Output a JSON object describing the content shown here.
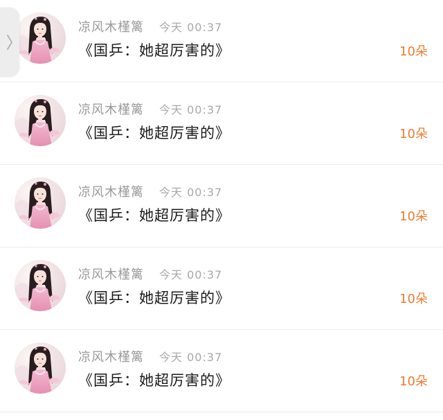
{
  "colors": {
    "name": "#9a9a9a",
    "time": "#a8a8a8",
    "title": "#1a1a1a",
    "count": "#ef7b2e",
    "divider": "#ececec"
  },
  "side_handle": {
    "icon": "chevron-right-icon"
  },
  "rows": [
    {
      "name": "凉风木槿篱",
      "time": "今天 00:37",
      "title": "《国乒：她超厉害的》",
      "count": "10朵",
      "avatar": "avatar-image"
    },
    {
      "name": "凉风木槿篱",
      "time": "今天 00:37",
      "title": "《国乒：她超厉害的》",
      "count": "10朵",
      "avatar": "avatar-image"
    },
    {
      "name": "凉风木槿篱",
      "time": "今天 00:37",
      "title": "《国乒：她超厉害的》",
      "count": "10朵",
      "avatar": "avatar-image"
    },
    {
      "name": "凉风木槿篱",
      "time": "今天 00:37",
      "title": "《国乒：她超厉害的》",
      "count": "10朵",
      "avatar": "avatar-image"
    },
    {
      "name": "凉风木槿篱",
      "time": "今天 00:37",
      "title": "《国乒：她超厉害的》",
      "count": "10朵",
      "avatar": "avatar-image"
    }
  ]
}
